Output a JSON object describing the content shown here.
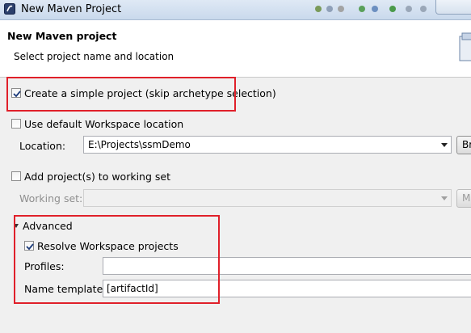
{
  "window": {
    "title": "New Maven Project"
  },
  "header": {
    "title": "New Maven project",
    "subtitle": "Select project name and location"
  },
  "options": {
    "simple_project": {
      "label": "Create a simple project (skip archetype selection)",
      "checked": true
    },
    "default_workspace": {
      "label": "Use default Workspace location",
      "checked": false
    },
    "location": {
      "label": "Location:",
      "value": "E:\\Projects\\ssmDemo",
      "browse_label": "Br"
    },
    "working_set_add": {
      "label": "Add project(s) to working set",
      "checked": false
    },
    "working_set": {
      "label": "Working set:",
      "value": "",
      "more_label": "M"
    }
  },
  "advanced": {
    "label": "Advanced",
    "resolve_workspace": {
      "label": "Resolve Workspace projects",
      "checked": true
    },
    "profiles": {
      "label": "Profiles:",
      "value": ""
    },
    "name_template": {
      "label": "Name template:",
      "value": "[artifactId]"
    }
  },
  "colors": {
    "highlight": "#e0202a",
    "header_bg": "#ffffff",
    "dialog_bg": "#f0f0f0"
  }
}
